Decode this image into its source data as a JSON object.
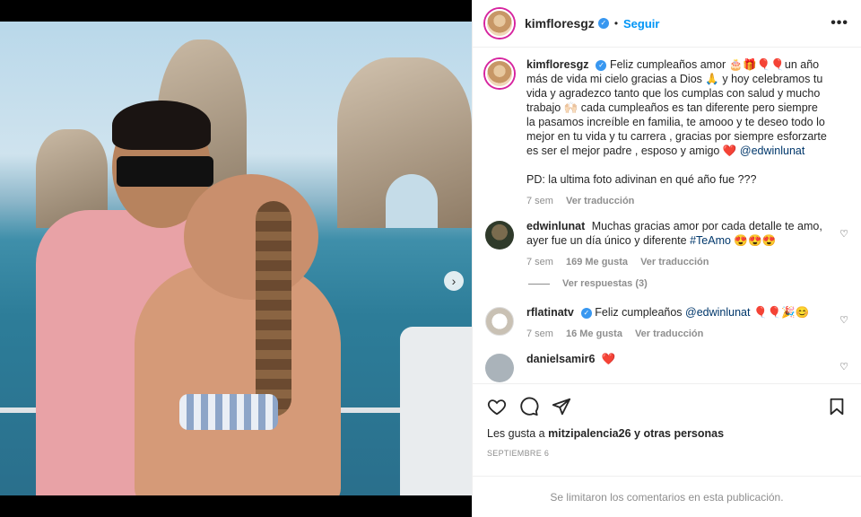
{
  "header": {
    "username": "kimfloresgz",
    "separator": "•",
    "follow_label": "Seguir",
    "more_label": "•••"
  },
  "caption": {
    "username": "kimfloresgz",
    "text": "Feliz cumpleaños amor 🎂🎁🎈🎈un año más de vida mi cielo gracias a Dios 🙏 y hoy celebramos tu vida y agradezco tanto que los cumplas con salud y mucho trabajo 🙌🏻 cada cumpleaños es tan diferente pero siempre la pasamos increíble en familia, te amooo y te deseo todo lo mejor en tu vida y tu carrera , gracias por siempre esforzarte es ser el mejor padre , esposo y amigo ❤️",
    "mention": "@edwinlunat",
    "pd": "PD: la ultima foto adivinan en qué año fue ???",
    "time": "7 sem",
    "translate": "Ver traducción"
  },
  "comments": [
    {
      "username": "edwinlunat",
      "text": "Muchas gracias amor por cada detalle te amo, ayer fue un día único y diferente",
      "hashtag": "#TeAmo",
      "emojis": "😍😍😍",
      "time": "7 sem",
      "likes": "169 Me gusta",
      "translate": "Ver traducción",
      "replies": "Ver respuestas (3)"
    },
    {
      "username": "rflatinatv",
      "text": "Feliz cumpleaños",
      "mention": "@edwinlunat",
      "emojis": "🎈🎈🎉😊",
      "time": "7 sem",
      "likes": "16 Me gusta",
      "translate": "Ver traducción"
    },
    {
      "username": "danielsamir6",
      "emojis": "❤️"
    }
  ],
  "likes_line": {
    "prefix": "Les gusta a",
    "user": "mitzipalencia26",
    "suffix": "y otras personas"
  },
  "date": "SEPTIEMBRE 6",
  "footer": "Se limitaron los comentarios en esta publicación.",
  "carousel": {
    "total": 3,
    "active": 0
  },
  "colors": {
    "accent": "#0095f6",
    "verified": "#3897f0",
    "heart": "#ed4956"
  }
}
